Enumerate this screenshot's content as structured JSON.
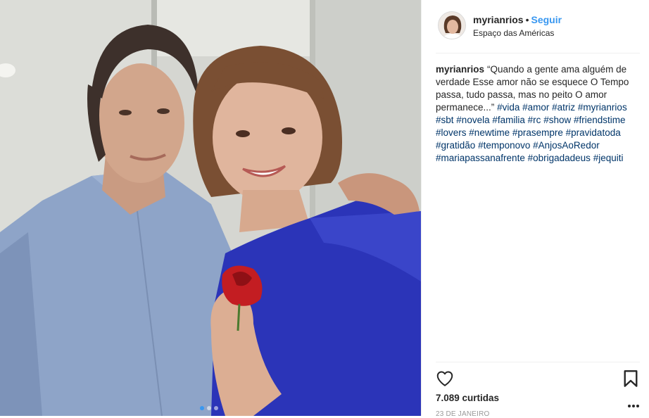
{
  "post": {
    "username": "myrianrios",
    "separator": "•",
    "follow_label": "Seguir",
    "location": "Espaço das Américas",
    "caption_user": "myrianrios",
    "caption_text": "“Quando a gente ama alguém de verdade Esse amor não se esquece O Tempo passa, tudo passa, mas no peito O amor permanece...”",
    "hashtags": [
      "#vida",
      "#amor",
      "#atriz",
      "#myrianrios",
      "#sbt",
      "#novela",
      "#familia",
      "#rc",
      "#show",
      "#friendstime",
      "#lovers",
      "#newtime",
      "#prasempre",
      "#pravidatoda",
      "#gratidão",
      "#temponovo",
      "#AnjosAoRedor",
      "#mariapassanafrente",
      "#obrigadadeus",
      "#jequiti"
    ],
    "likes": "7.089 curtidas",
    "date": "23 de janeiro"
  },
  "carousel": {
    "slides": 3,
    "active_index": 0
  },
  "colors": {
    "link_blue": "#3897f0",
    "hashtag_blue": "#003569",
    "text": "#262626",
    "muted": "#999999",
    "border": "#efefef"
  },
  "icons": [
    "heart-icon",
    "bookmark-icon",
    "more-options-icon"
  ]
}
